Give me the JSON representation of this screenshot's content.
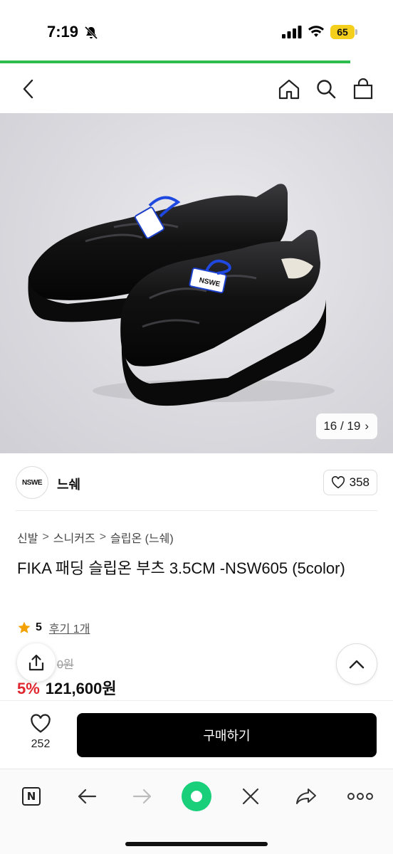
{
  "status_bar": {
    "time": "7:19",
    "battery": "65"
  },
  "header": {
    "icons": [
      "back-arrow-icon",
      "home-icon",
      "search-icon",
      "shopping-bag-icon"
    ]
  },
  "gallery": {
    "counter": "16 / 19",
    "next_glyph": "›",
    "logo_text": "NSWE"
  },
  "brand": {
    "logo_text": "NSWE",
    "name": "느쉐",
    "like_count": "358"
  },
  "breadcrumb": [
    "신발",
    "스니커즈",
    "슬립온 (느쉐)"
  ],
  "breadcrumb_separator": ">",
  "product": {
    "title": "FIKA 패딩 슬립온 부츠 3.5CM -NSW605 (5color)",
    "rating": "5",
    "review_text": "후기 1개",
    "original_price": "0원",
    "discount": "5%",
    "price": "121,600원"
  },
  "purchase_bar": {
    "wish_count": "252",
    "buy_label": "구매하기"
  },
  "colors": {
    "accent_green": "#2dbd4f",
    "discount_red": "#e0262f",
    "star": "#f2a100",
    "naver_green": "#19cf7a"
  }
}
